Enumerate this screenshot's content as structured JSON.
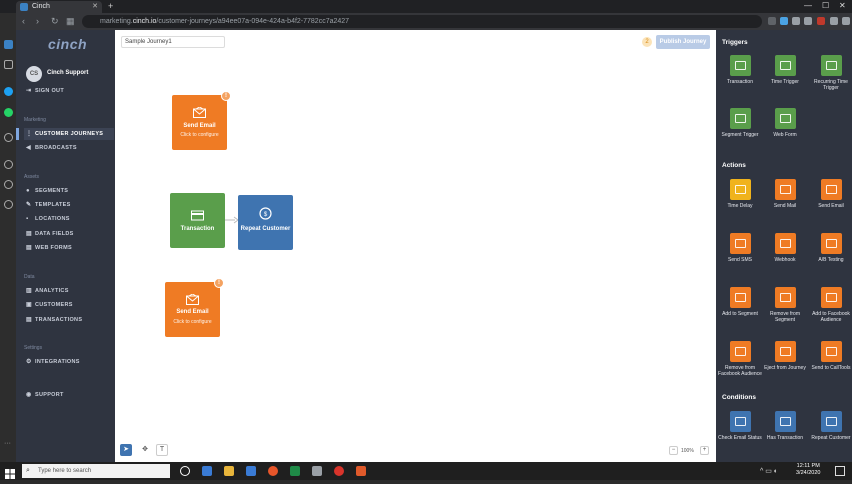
{
  "browser": {
    "tab_title": "Cinch",
    "url_prefix": "marketing.",
    "url_host": "cinch.io",
    "url_path": "/customer-journeys/a94ee07a-094e-424a-b4f2-7782cc7a2427"
  },
  "sidebar": {
    "logo": "cinch",
    "avatar_initials": "CS",
    "user_name": "Cinch Support",
    "sign_out": "SIGN OUT",
    "sections": {
      "marketing": "Marketing",
      "assets": "Assets",
      "data": "Data",
      "settings": "Settings"
    },
    "items": {
      "customer_journeys": "CUSTOMER JOURNEYS",
      "broadcasts": "BROADCASTS",
      "segments": "SEGMENTS",
      "templates": "TEMPLATES",
      "locations": "LOCATIONS",
      "data_fields": "DATA FIELDS",
      "web_forms": "WEB FORMS",
      "analytics": "ANALYTICS",
      "customers": "CUSTOMERS",
      "transactions": "TRANSACTIONS",
      "integrations": "INTEGRATIONS",
      "support": "SUPPORT"
    }
  },
  "canvas": {
    "journey_name": "Sample Journey1",
    "issue_count": "2",
    "publish_label": "Publish Journey",
    "zoom": "100%",
    "nodes": {
      "send_email_1": {
        "title": "Send Email",
        "sub": "Click to configure",
        "warn": "!"
      },
      "transaction": {
        "title": "Transaction"
      },
      "repeat_customer": {
        "title": "Repeat Customer"
      },
      "send_email_2": {
        "title": "Send Email",
        "sub": "Click to configure",
        "warn": "!"
      }
    }
  },
  "panel": {
    "triggers_heading": "Triggers",
    "actions_heading": "Actions",
    "conditions_heading": "Conditions",
    "triggers": [
      "Transaction",
      "Time Trigger",
      "Recurring Time Trigger",
      "Segment Trigger",
      "Web Form"
    ],
    "actions": [
      "Time Delay",
      "Send Mail",
      "Send Email",
      "Send SMS",
      "Webhook",
      "A/B Testing",
      "Add to Segment",
      "Remove from Segment",
      "Add to Facebook Audience",
      "Remove from Facebook Audience",
      "Eject from Journey",
      "Send to CallTools"
    ],
    "conditions": [
      "Check Email Status",
      "Has Transaction",
      "Repeat Customer"
    ],
    "colors": {
      "trigger": "#5a9e4b",
      "time_delay": "#f0b31c",
      "action": "#ef7b24",
      "condition": "#3f74b0"
    }
  },
  "taskbar": {
    "search_placeholder": "Type here to search",
    "time": "12:11 PM",
    "date": "3/24/2020"
  }
}
